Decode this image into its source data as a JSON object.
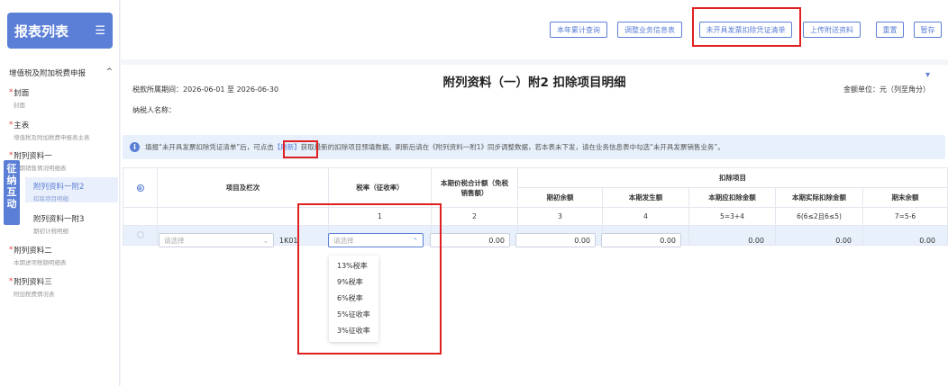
{
  "sidebar": {
    "title": "报表列表",
    "menu_icon": "menu-icon",
    "group": "增值税及附加税费申报",
    "group_toggle": "^",
    "items": [
      {
        "label": "封面",
        "sub": "封面"
      },
      {
        "label": "主表",
        "sub": "增值税及附加税费申报表主表"
      },
      {
        "label": "附列资料一",
        "sub": "本期销售情况明细表"
      },
      {
        "label": "附列资料二",
        "sub": "本期进项税额明细表"
      },
      {
        "label": "附列资料三",
        "sub": "附加税费情况表"
      }
    ],
    "subitems": [
      {
        "label": "附列资料一附2",
        "sub": "扣除项目明细"
      },
      {
        "label": "附列资料一附3",
        "sub": "期初计税明细"
      }
    ],
    "vertical_tab": [
      "征",
      "纳",
      "互",
      "动"
    ]
  },
  "toolbar": {
    "buttons": [
      "本年累计查询",
      "调整业务信息表",
      "未开具发票扣除凭证清单",
      "上传附送资料",
      "重置",
      "暂存"
    ]
  },
  "main": {
    "title": "附列资料（一）附2 扣除项目明细",
    "period": "税款所属期间：2026-06-01 至 2026-06-30",
    "taxpayer": "纳税人名称：",
    "unit": "金额单位：元（列至角分）",
    "notice_a": "填报“未开具发票扣除凭证清单”后，可点击",
    "notice_link": "【刷新】",
    "notice_b": "获取最新的扣除项目预填数据。刷新后请在《附列资料一附1》同步调整数据，若本表未下发，请在业务信息表中勾选“未开具发票销售业务”。"
  },
  "table": {
    "headers": {
      "add": "⊕",
      "item": "项目及栏次",
      "rate": "税率（征收率）",
      "total": "本期价税合计额（免税销售额）",
      "deduct": "扣除项目",
      "opening": "期初余额",
      "current": "本期发生额",
      "should": "本期应扣除金额",
      "actual": "本期实际扣除金额",
      "closing": "期末余额"
    },
    "nums": [
      "1",
      "2",
      "3",
      "4",
      "5=3+4",
      "6(6≤2且6≤5)",
      "7=5-6"
    ],
    "row": {
      "item_placeholder": "请选择",
      "code": "1K01",
      "rate_placeholder": "请选择",
      "total": "0.00",
      "opening": "0.00",
      "current": "0.00",
      "should": "0.00",
      "actual": "0.00",
      "closing": "0.00"
    },
    "rate_options": [
      "13%税率",
      "9%税率",
      "6%税率",
      "5%征收率",
      "3%征收率"
    ]
  }
}
